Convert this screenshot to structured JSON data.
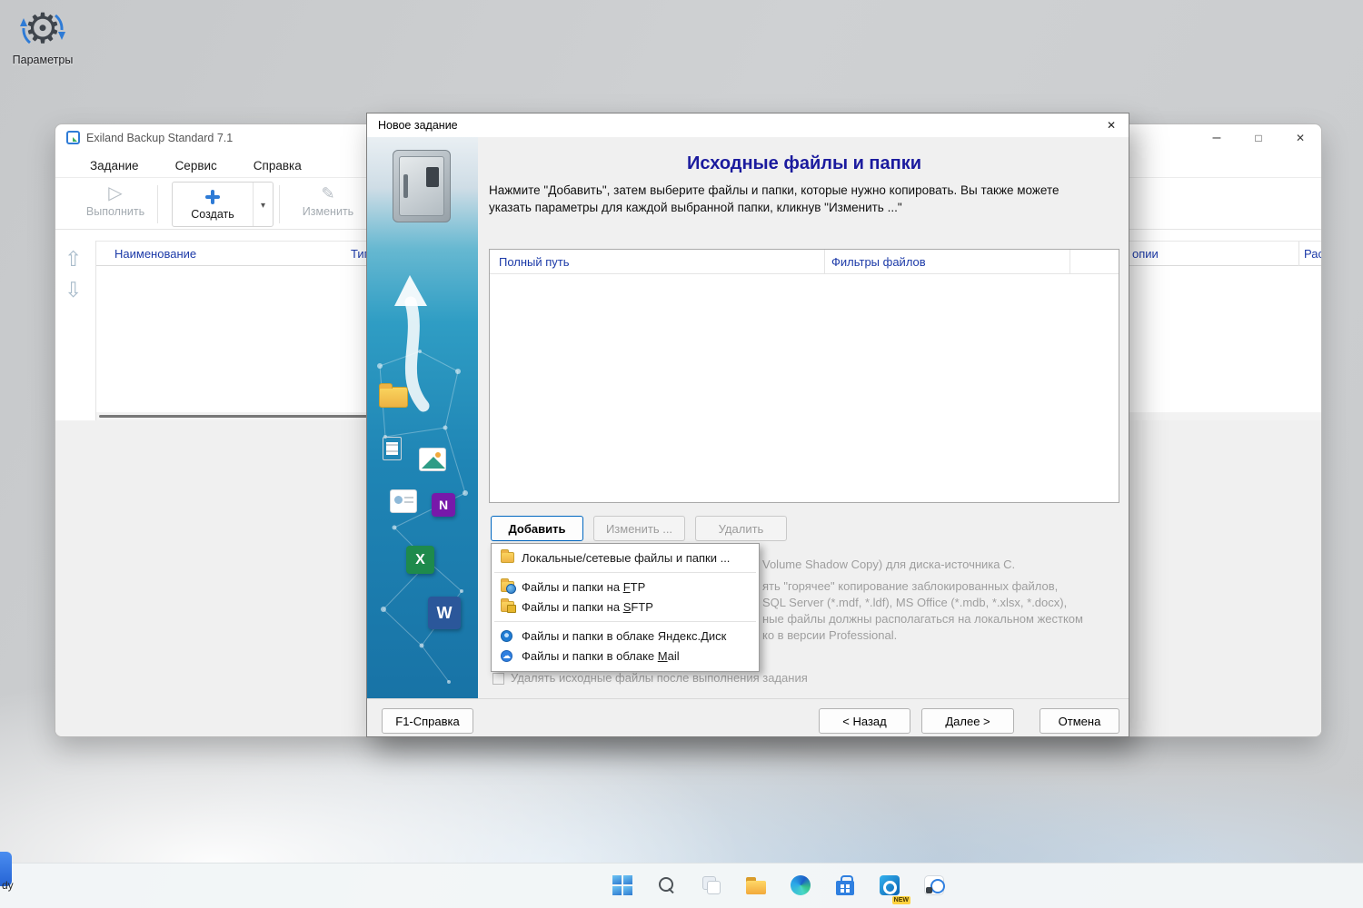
{
  "desktop": {
    "settings_label": "Параметры",
    "corner_text": "dy"
  },
  "app_window": {
    "title": "Exiland Backup Standard 7.1",
    "menu": {
      "task": "Задание",
      "service": "Сервис",
      "help": "Справка"
    },
    "toolbar": {
      "run": "Выполнить",
      "create": "Создать",
      "edit": "Изменить"
    },
    "columns": {
      "name": "Наименование",
      "type": "Тип",
      "copies": "опии",
      "schedule": "Рас"
    }
  },
  "dialog": {
    "title": "Новое задание",
    "heading": "Исходные файлы и папки",
    "description": "Нажмите \"Добавить\", затем выберите файлы и папки, которые нужно копировать. Вы также можете указать параметры для каждой выбранной папки, кликнув \"Изменить ...\"",
    "table": {
      "col_path": "Полный путь",
      "col_filters": "Фильтры файлов"
    },
    "buttons": {
      "add": "Добавить",
      "edit": "Изменить ...",
      "remove": "Удалить"
    },
    "add_menu": {
      "items": [
        {
          "pre": "Локальные/сетевые файлы и папки ...",
          "key": "",
          "post": "",
          "icon": "folder-icon"
        },
        {
          "pre": "Файлы и папки на ",
          "key": "F",
          "post": "TP",
          "icon": "ftp-folder-icon"
        },
        {
          "pre": "Файлы и папки на ",
          "key": "S",
          "post": "FTP",
          "icon": "sftp-folder-icon"
        },
        {
          "pre": "Файлы и папки в облаке Яндекс.Диск",
          "key": "",
          "post": "",
          "icon": "yandex-disk-icon"
        },
        {
          "pre": "Файлы и папки в облаке ",
          "key": "M",
          "post": "ail",
          "icon": "mail-cloud-icon"
        }
      ]
    },
    "obscured_text": [
      "Volume Shadow Copy) для диска-источника C.",
      "ять \"горячее\" копирование заблокированных файлов,",
      "SQL Server (*.mdf, *.ldf), MS Office (*.mdb, *.xlsx, *.docx),",
      "ные файлы должны располагаться на локальном жестком",
      "ко в версии Professional."
    ],
    "checkbox_label": "Удалять исходные файлы после выполнения задания",
    "footer": {
      "help": "F1-Справка",
      "back": "< Назад",
      "next": "Далее >",
      "cancel": "Отмена"
    },
    "sidebar_glyphs": {
      "onenote": "N",
      "excel": "X",
      "word": "W"
    }
  },
  "taskbar": {
    "outlook_badge": "NEW",
    "icons": [
      "start",
      "search",
      "task-view",
      "file-explorer",
      "edge",
      "store",
      "outlook",
      "clock"
    ]
  }
}
